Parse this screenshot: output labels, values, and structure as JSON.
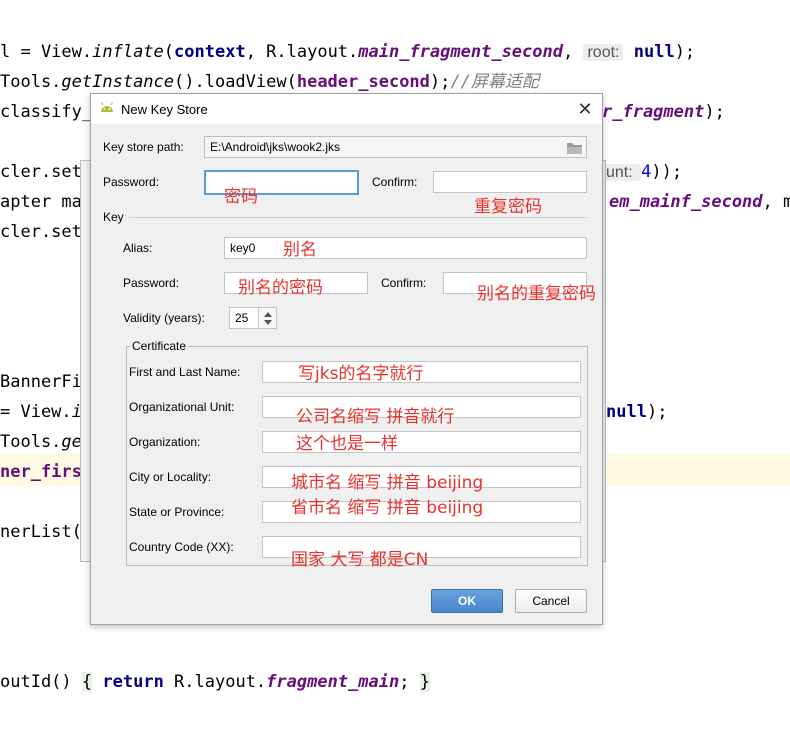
{
  "editor": {
    "lines": [
      {
        "id": "l1",
        "parts": [
          {
            "t": "l = View.",
            "c": ""
          },
          {
            "t": "inflate",
            "c": "it"
          },
          {
            "t": "(",
            "c": ""
          },
          {
            "t": "context",
            "c": "kw"
          },
          {
            "t": ", R.layout.",
            "c": ""
          },
          {
            "t": "main_fragment_second",
            "c": "fldi"
          },
          {
            "t": ", ",
            "c": ""
          },
          {
            "t": "root:",
            "c": "hint"
          },
          {
            "t": " ",
            "c": ""
          },
          {
            "t": "null",
            "c": "kw"
          },
          {
            "t": ");",
            "c": ""
          }
        ]
      },
      {
        "id": "l2",
        "parts": [
          {
            "t": "Tools.",
            "c": ""
          },
          {
            "t": "getInstance",
            "c": "it"
          },
          {
            "t": "().loadView(",
            "c": ""
          },
          {
            "t": "header_second",
            "c": "fld"
          },
          {
            "t": ");",
            "c": ""
          },
          {
            "t": "//屏幕适配",
            "c": "cm"
          }
        ]
      },
      {
        "id": "l3",
        "parts": [
          {
            "t": "classify_",
            "c": ""
          }
        ]
      },
      {
        "id": "l3r",
        "parts": [
          {
            "t": "r_fragment",
            "c": "fldi"
          },
          {
            "t": ");",
            "c": ""
          }
        ]
      },
      {
        "id": "l4",
        "parts": [
          {
            "t": "cler.set",
            "c": ""
          }
        ]
      },
      {
        "id": "l4r",
        "parts": [
          {
            "t": "unt: ",
            "c": "hint"
          },
          {
            "t": "4",
            "c": "num"
          },
          {
            "t": "));",
            "c": ""
          }
        ]
      },
      {
        "id": "l5",
        "parts": [
          {
            "t": "apter ma",
            "c": ""
          }
        ]
      },
      {
        "id": "l5r",
        "parts": [
          {
            "t": "em_mainf_second",
            "c": "fldi"
          },
          {
            "t": ", m",
            "c": ""
          }
        ]
      },
      {
        "id": "l6",
        "parts": [
          {
            "t": "cler.set",
            "c": ""
          }
        ]
      },
      {
        "id": "l7",
        "parts": [
          {
            "t": "BannerFi",
            "c": ""
          }
        ]
      },
      {
        "id": "l8",
        "parts": [
          {
            "t": "= View.",
            "c": ""
          },
          {
            "t": "i",
            "c": "it"
          }
        ]
      },
      {
        "id": "l8r",
        "parts": [
          {
            "t": "null",
            "c": "kw"
          },
          {
            "t": ");",
            "c": ""
          }
        ]
      },
      {
        "id": "l9",
        "parts": [
          {
            "t": "Tools.",
            "c": ""
          },
          {
            "t": "ge",
            "c": "it"
          }
        ]
      },
      {
        "id": "l10",
        "parts": [
          {
            "t": "ner_first",
            "c": "fld"
          }
        ]
      },
      {
        "id": "l11",
        "parts": [
          {
            "t": "nerList(",
            "c": ""
          }
        ]
      },
      {
        "id": "l12",
        "parts": [
          {
            "t": "outId() ",
            "c": ""
          },
          {
            "t": "{",
            "c": "brace"
          },
          {
            "t": " ",
            "c": ""
          },
          {
            "t": "return",
            "c": "kw"
          },
          {
            "t": " R.layout.",
            "c": ""
          },
          {
            "t": "fragment_main",
            "c": "fldi"
          },
          {
            "t": ";",
            "c": ""
          },
          {
            "t": " ",
            "c": ""
          },
          {
            "t": "}",
            "c": "brace"
          }
        ]
      }
    ]
  },
  "dialog": {
    "title": "New Key Store",
    "close_icon": "close-icon",
    "keystore_path_label": "Key store path:",
    "keystore_path_value": "E:\\Android\\jks\\wook2.jks",
    "password_label": "Password:",
    "password_value": "",
    "confirm_label": "Confirm:",
    "confirm_value": "",
    "key_section_label": "Key",
    "alias_label": "Alias:",
    "alias_value": "key0",
    "key_password_label": "Password:",
    "key_confirm_label": "Confirm:",
    "validity_label": "Validity (years):",
    "validity_value": "25",
    "certificate_label": "Certificate",
    "first_last_label": "First and Last Name:",
    "org_unit_label": "Organizational Unit:",
    "organization_label": "Organization:",
    "city_label": "City or Locality:",
    "state_label": "State or Province:",
    "country_label": "Country Code (XX):",
    "ok_label": "OK",
    "cancel_label": "Cancel"
  },
  "annotations": {
    "password": "密码",
    "confirm": "重复密码",
    "alias": "别名",
    "key_password": "别名的密码",
    "key_confirm": "别名的重复密码",
    "first_last": "写jks的名字就行",
    "org_unit": "公司名缩写  拼音就行",
    "organization": "这个也是一样",
    "city": "城市名 缩写  拼音  beijing",
    "state": "省市名 缩写  拼音  beijing",
    "country": "国家    大写  都是CN"
  },
  "colors": {
    "annotation": "#e8322e",
    "ok_button": "#4a86cf",
    "focus_border": "#5b9bd5"
  }
}
